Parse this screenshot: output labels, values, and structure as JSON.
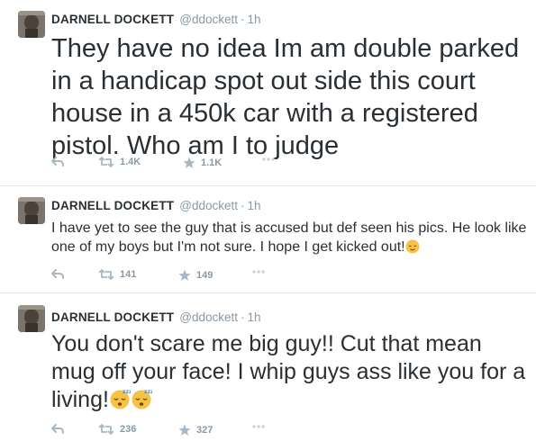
{
  "tweets": [
    {
      "name": "DARNELL DOCKETT",
      "handle": "@ddockett",
      "dot": "·",
      "time": "1h",
      "text": "They have no idea Im am double parked in a handicap spot out side this court house in a 450k car with a registered pistol. Who am I to judge",
      "retweets": "1.4K",
      "favorites": "1.1K"
    },
    {
      "name": "DARNELL DOCKETT",
      "handle": "@ddockett",
      "dot": "·",
      "time": "1h",
      "text": "I have yet to see the guy that is accused but def seen his pics. He look like one of my boys but I'm not sure. I hope I get kicked out!",
      "emoji": "relieved-face-emoji",
      "retweets": "141",
      "favorites": "149"
    },
    {
      "name": "DARNELL DOCKETT",
      "handle": "@ddockett",
      "dot": "·",
      "time": "1h",
      "text": "You don't scare me big guy!!  Cut that mean mug off your face! I whip guys ass like you for a living!",
      "emoji": "sleeping-face-emoji",
      "retweets": "236",
      "favorites": "327"
    }
  ],
  "icons": [
    "reply-icon",
    "retweet-icon",
    "favorite-star-icon",
    "more-icon",
    "avatar"
  ],
  "colors": {
    "text": "#292f33",
    "muted": "#8899a6",
    "action_icon": "#aab8c2",
    "divider": "#e1e8ed",
    "emoji": "#f7c244"
  }
}
